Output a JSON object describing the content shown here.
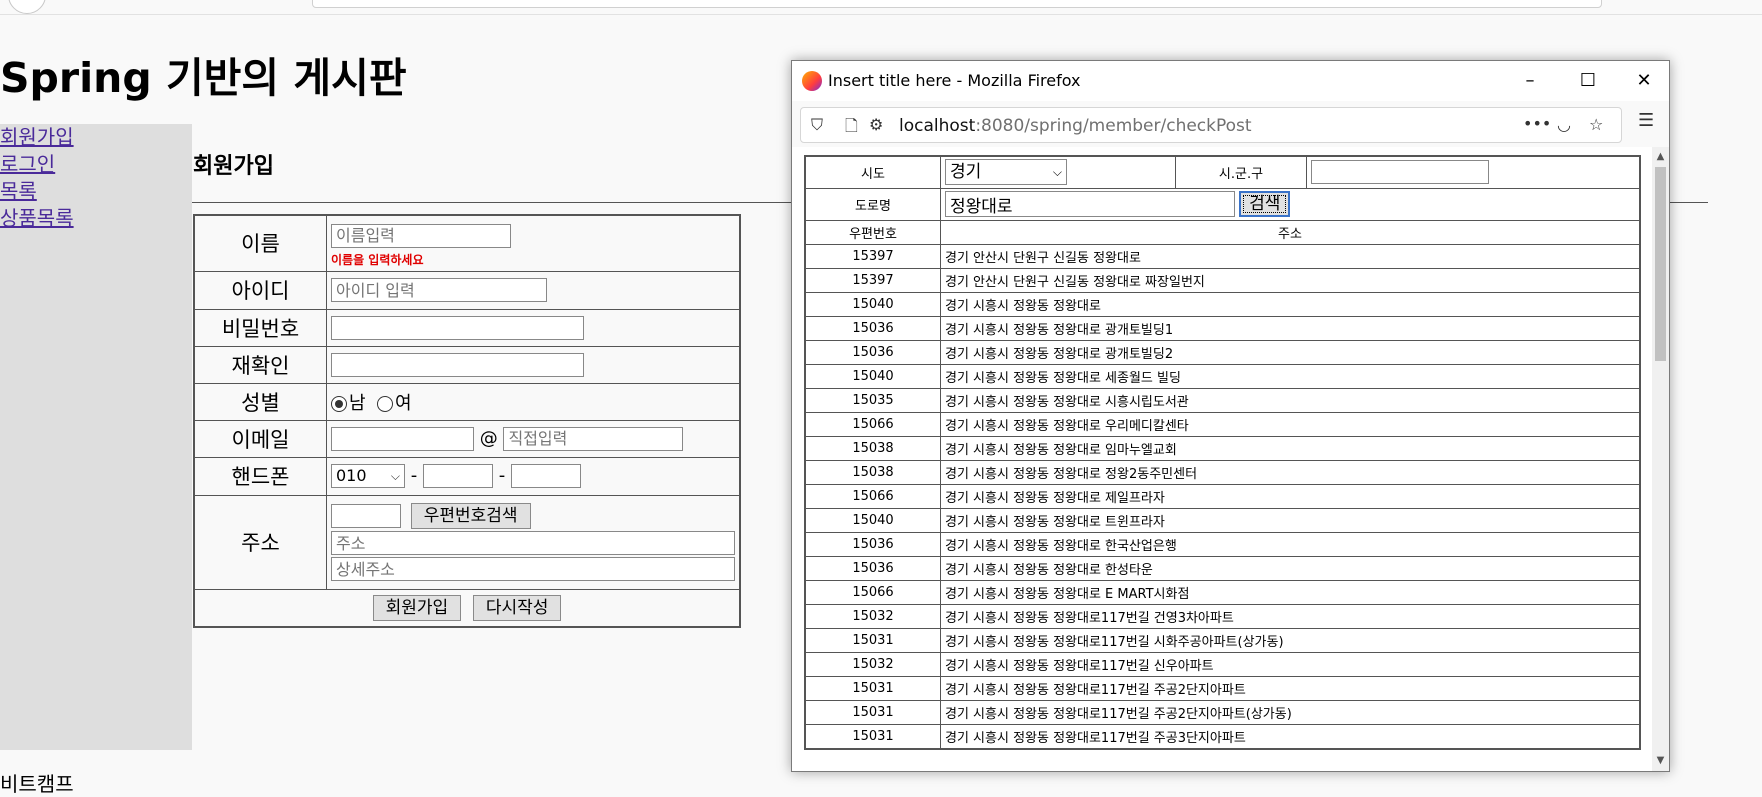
{
  "page": {
    "title": "Spring 기반의 게시판",
    "section_title": "회원가입",
    "footer_text": "비트캠프"
  },
  "sidebar": {
    "items": [
      {
        "label": "회원가입"
      },
      {
        "label": "로그인"
      },
      {
        "label": "목록"
      },
      {
        "label": "상품목록"
      }
    ]
  },
  "form": {
    "name_label": "이름",
    "name_placeholder": "이름입력",
    "name_error": "이름을 입력하세요",
    "id_label": "아이디",
    "id_placeholder": "아이디 입력",
    "pwd_label": "비밀번호",
    "repwd_label": "재확인",
    "gender_label": "성별",
    "gender_male": "남",
    "gender_female": "여",
    "email_label": "이메일",
    "email_at": "@",
    "email_domain_placeholder": "직접입력",
    "phone_label": "핸드폰",
    "phone_prefix": "010",
    "phone_dash": "-",
    "addr_label": "주소",
    "zip_search_button": "우편번호검색",
    "addr_placeholder": "주소",
    "addr_detail_placeholder": "상세주소",
    "submit_button": "회원가입",
    "reset_button": "다시작성"
  },
  "popup": {
    "window_title": "Insert title here - Mozilla Firefox",
    "minimize": "–",
    "maximize": "☐",
    "close": "✕",
    "url_host": "localhost",
    "url_rest": ":8080/spring/member/checkPost",
    "more_icon": "•••",
    "sido_label": "시도",
    "sido_value": "경기",
    "sigungu_label": "시.군.구",
    "road_label": "도로명",
    "road_value": "정왕대로",
    "search_button": "검색",
    "col_zip": "우편번호",
    "col_addr": "주소",
    "rows": [
      {
        "zip": "15397",
        "addr": "경기 안산시 단원구 신길동 정왕대로"
      },
      {
        "zip": "15397",
        "addr": "경기 안산시 단원구 신길동 정왕대로 짜장일번지"
      },
      {
        "zip": "15040",
        "addr": "경기 시흥시 정왕동 정왕대로"
      },
      {
        "zip": "15036",
        "addr": "경기 시흥시 정왕동 정왕대로 광개토빌딩1"
      },
      {
        "zip": "15036",
        "addr": "경기 시흥시 정왕동 정왕대로 광개토빌딩2"
      },
      {
        "zip": "15040",
        "addr": "경기 시흥시 정왕동 정왕대로 세종월드 빌딩"
      },
      {
        "zip": "15035",
        "addr": "경기 시흥시 정왕동 정왕대로 시흥시립도서관"
      },
      {
        "zip": "15066",
        "addr": "경기 시흥시 정왕동 정왕대로 우리메디칼센타"
      },
      {
        "zip": "15038",
        "addr": "경기 시흥시 정왕동 정왕대로 임마누엘교회"
      },
      {
        "zip": "15038",
        "addr": "경기 시흥시 정왕동 정왕대로 정왕2동주민센터"
      },
      {
        "zip": "15066",
        "addr": "경기 시흥시 정왕동 정왕대로 제일프라자"
      },
      {
        "zip": "15040",
        "addr": "경기 시흥시 정왕동 정왕대로 트윈프라자"
      },
      {
        "zip": "15036",
        "addr": "경기 시흥시 정왕동 정왕대로 한국산업은행"
      },
      {
        "zip": "15036",
        "addr": "경기 시흥시 정왕동 정왕대로 한성타운"
      },
      {
        "zip": "15066",
        "addr": "경기 시흥시 정왕동 정왕대로 E MART시화점"
      },
      {
        "zip": "15032",
        "addr": "경기 시흥시 정왕동 정왕대로117번길 건영3차아파트"
      },
      {
        "zip": "15031",
        "addr": "경기 시흥시 정왕동 정왕대로117번길 시화주공아파트(상가동)"
      },
      {
        "zip": "15032",
        "addr": "경기 시흥시 정왕동 정왕대로117번길 신우아파트"
      },
      {
        "zip": "15031",
        "addr": "경기 시흥시 정왕동 정왕대로117번길 주공2단지아파트"
      },
      {
        "zip": "15031",
        "addr": "경기 시흥시 정왕동 정왕대로117번길 주공2단지아파트(상가동)"
      },
      {
        "zip": "15031",
        "addr": "경기 시흥시 정왕동 정왕대로117번길 주공3단지아파트"
      }
    ]
  }
}
